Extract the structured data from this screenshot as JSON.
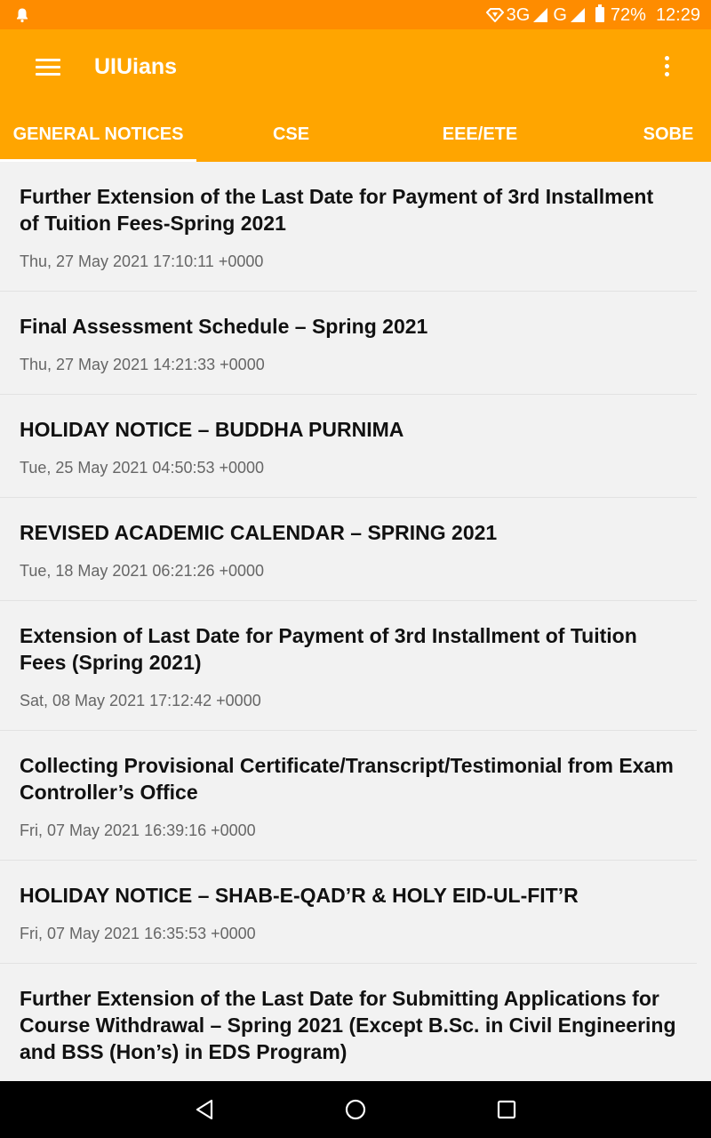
{
  "status_bar": {
    "network": "3G",
    "network2": "G",
    "battery": "72%",
    "time": "12:29"
  },
  "app": {
    "title": "UIUians",
    "tabs": [
      {
        "label": "GENERAL NOTICES",
        "active": true
      },
      {
        "label": "CSE",
        "active": false
      },
      {
        "label": "EEE/ETE",
        "active": false
      },
      {
        "label": "SOBE",
        "active": false
      }
    ]
  },
  "notices": [
    {
      "title": "Further Extension of the Last Date for Payment of 3rd Installment of Tuition Fees-Spring 2021",
      "date": "Thu, 27 May 2021 17:10:11 +0000"
    },
    {
      "title": "Final Assessment Schedule – Spring 2021",
      "date": "Thu, 27 May 2021 14:21:33 +0000"
    },
    {
      "title": "HOLIDAY NOTICE – BUDDHA PURNIMA",
      "date": "Tue, 25 May 2021 04:50:53 +0000"
    },
    {
      "title": "REVISED ACADEMIC CALENDAR – SPRING 2021",
      "date": "Tue, 18 May 2021 06:21:26 +0000"
    },
    {
      "title": "Extension of Last Date for Payment of 3rd Installment of Tuition Fees (Spring 2021)",
      "date": "Sat, 08 May 2021 17:12:42 +0000"
    },
    {
      "title": "Collecting Provisional Certificate/Transcript/Testimonial from Exam Controller’s Office",
      "date": "Fri, 07 May 2021 16:39:16 +0000"
    },
    {
      "title": "HOLIDAY NOTICE – SHAB-E-QAD’R & HOLY EID-UL-FIT’R",
      "date": "Fri, 07 May 2021 16:35:53 +0000"
    },
    {
      "title": "Further Extension of the Last Date for Submitting Applications for Course Withdrawal – Spring 2021 (Except B.Sc. in Civil Engineering and BSS (Hon’s) in EDS Program)",
      "date": ""
    }
  ],
  "icons": {
    "notification": "bell-icon",
    "menu": "hamburger-menu-icon",
    "overflow": "more-vertical-icon",
    "back": "back-triangle-icon",
    "home": "home-circle-icon",
    "recents": "recents-square-icon"
  }
}
